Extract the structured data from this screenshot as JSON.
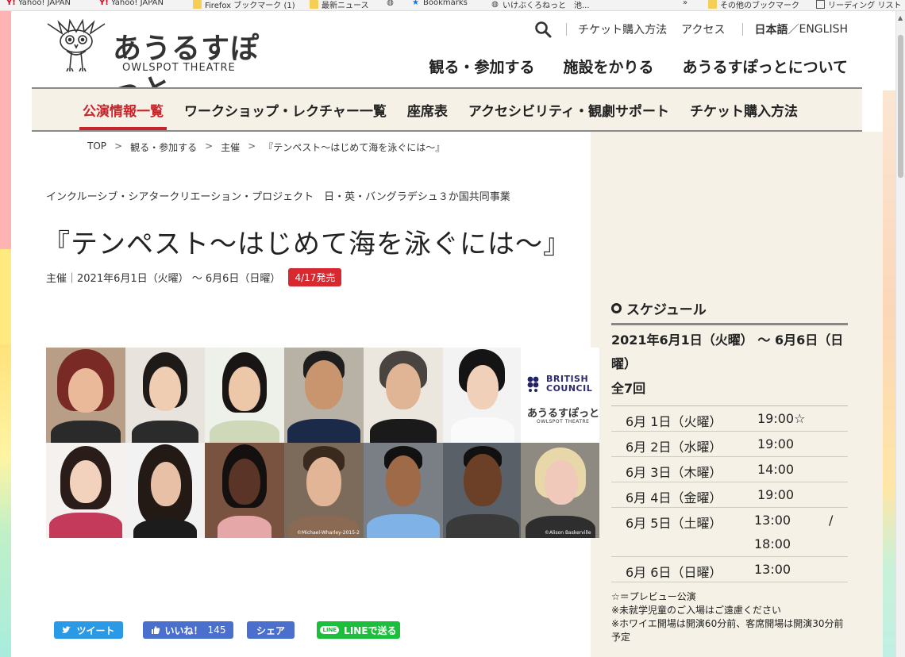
{
  "bookmarks": [
    {
      "icon": "yahoo-icon",
      "label": "Yahoo! JAPAN"
    },
    {
      "icon": "yahoo-icon",
      "label": "Yahoo! JAPAN"
    },
    {
      "icon": "folder-icon",
      "label": "Firefox ブックマーク (1)"
    },
    {
      "icon": "folder-icon",
      "label": "最新ニュース"
    },
    {
      "icon": "globe-icon",
      "label": ""
    },
    {
      "icon": "star-icon",
      "label": "Bookmarks"
    },
    {
      "icon": "globe-icon",
      "label": "いけぶくろねっと　池..."
    },
    {
      "icon": "chevron-right-icon",
      "label": "»"
    },
    {
      "icon": "folder-icon",
      "label": "その他のブックマーク"
    },
    {
      "icon": "reading-list-icon",
      "label": "リーディング リスト"
    }
  ],
  "logo": {
    "jp": "あうるすぽっと",
    "en": "OWLSPOT THEATRE"
  },
  "util_nav": {
    "ticket": "チケット購入方法",
    "access": "アクセス",
    "lang_ja": "日本語",
    "lang_sep": "／",
    "lang_en": "ENGLISH"
  },
  "main_nav": [
    "観る・参加する",
    "施設をかりる",
    "あうるすぽっとについて"
  ],
  "sub_nav": [
    "公演情報一覧",
    "ワークショップ・レクチャー一覧",
    "座席表",
    "アクセシビリティ・観劇サポート",
    "チケット購入方法"
  ],
  "breadcrumb": [
    "TOP",
    "観る・参加する",
    "主催",
    "『テンペスト～はじめて海を泳ぐには～』"
  ],
  "breadcrumb_sep": ">",
  "event": {
    "subtitle": "インクルーシブ・シアタークリエーション・プロジェクト　日・英・バングラデシュ３か国共同事業",
    "title": "『テンペスト～はじめて海を泳ぐには～』",
    "meta": "主催｜2021年6月1日（火曜） ～ 6月6日（日曜）",
    "badge": "4/17発売"
  },
  "cast_image": {
    "partner_logo": "BRITISH\nCOUNCIL",
    "logo_jp": "あうるすぽっと",
    "logo_en": "OWLSPOT THEATRE",
    "credit1": "©Michael-Wharley-2015-2",
    "credit2": "©Alison Baskerville"
  },
  "social": {
    "tweet": "ツイート",
    "like": "いいね！",
    "like_count": "145",
    "share": "シェア",
    "line_pill": "LINE",
    "line": "LINEで送る"
  },
  "schedule": {
    "heading": "スケジュール",
    "period": "2021年6月1日（火曜） ～ 6月6日（日曜）",
    "count": "全7回",
    "rows": [
      {
        "date": "6月 1日（火曜）",
        "time": "19:00☆"
      },
      {
        "date": "6月 2日（水曜）",
        "time": "19:00"
      },
      {
        "date": "6月 3日（木曜）",
        "time": "14:00"
      },
      {
        "date": "6月 4日（金曜）",
        "time": "19:00"
      },
      {
        "date": "6月 5日（土曜）",
        "time": "13:00",
        "sep": "/",
        "time2": "18:00"
      },
      {
        "date": "6月 6日（日曜）",
        "time": "13:00"
      }
    ],
    "notes": [
      "☆＝プレビュー公演",
      "※未就学児童のご入場はご遠慮ください",
      "※ホワイエ開場は開演60分前、客席開場は開演30分前予定"
    ]
  },
  "colors": {
    "accent_red": "#c8242b",
    "beige": "#f5f1e6",
    "badge_red": "#d7272f",
    "twitter": "#2a9ae6",
    "facebook": "#4a6fcc",
    "line": "#1cbf3b"
  }
}
